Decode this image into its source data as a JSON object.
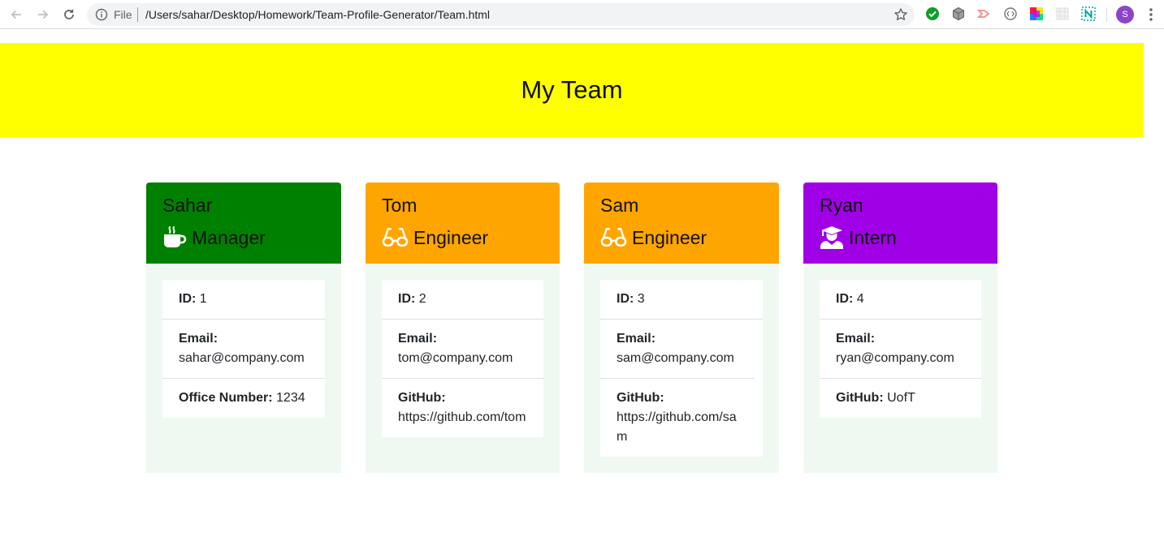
{
  "browser": {
    "scheme": "File",
    "url": "/Users/sahar/Desktop/Homework/Team-Profile-Generator/Team.html",
    "avatar_letter": "S"
  },
  "page": {
    "title": "My Team"
  },
  "cards": [
    {
      "name": "Sahar",
      "role": "Manager",
      "icon": "coffee-mug-icon",
      "color": "#008000",
      "id_label": "ID:",
      "id": "1",
      "email_label": "Email:",
      "email": "sahar@company.com",
      "extra_label": "Office Number:",
      "extra": "1234"
    },
    {
      "name": "Tom",
      "role": "Engineer",
      "icon": "glasses-icon",
      "color": "#ffa500",
      "id_label": "ID:",
      "id": "2",
      "email_label": "Email:",
      "email": "tom@company.com",
      "extra_label": "GitHub:",
      "extra": "https://github.com/tom"
    },
    {
      "name": "Sam",
      "role": "Engineer",
      "icon": "glasses-icon",
      "color": "#ffa500",
      "id_label": "ID:",
      "id": "3",
      "email_label": "Email:",
      "email": "sam@company.com",
      "extra_label": "GitHub:",
      "extra": "https://github.com/sam"
    },
    {
      "name": "Ryan",
      "role": "Intern",
      "icon": "graduate-icon",
      "color": "#a000e6",
      "id_label": "ID:",
      "id": "4",
      "email_label": "Email:",
      "email": "ryan@company.com",
      "extra_label": "GitHub:",
      "extra": "UofT"
    }
  ]
}
